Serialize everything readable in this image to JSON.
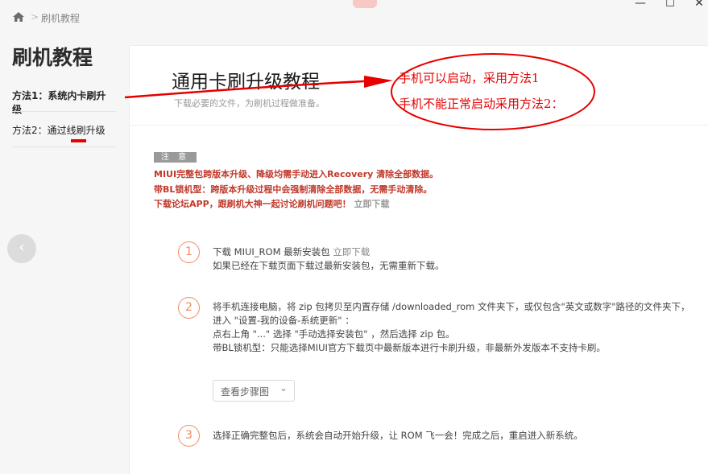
{
  "titlebar": {
    "breadcrumb": "刷机教程",
    "separator": ">",
    "window_controls": [
      "—",
      "☐",
      "✕"
    ]
  },
  "sidebar": {
    "title": "刷机教程",
    "items": [
      {
        "label": "方法1：系统内卡刷升级"
      },
      {
        "label": "方法2：通过线刷升级"
      }
    ],
    "back_glyph": "‹"
  },
  "content": {
    "title": "通用卡刷升级教程",
    "subtitle": "下载必要的文件，为刷机过程做准备。",
    "note_label": "注 意",
    "warnings": [
      "MIUI完整包跨版本升级、降级均需手动进入Recovery 清除全部数据。",
      "带BL锁机型：跨版本升级过程中会强制清除全部数据，无需手动清除。",
      "下载论坛APP，跟刷机大神一起讨论刷机问题吧！"
    ],
    "warning_link": "立即下载",
    "steps": [
      {
        "num": "1",
        "line1_prefix": "下载 MIUI_ROM 最新安装包 ",
        "line1_link": "立即下载",
        "line2": "如果已经在下载页面下载过最新安装包，无需重新下载。"
      },
      {
        "num": "2",
        "line1": "将手机连接电脑，将 zip 包拷贝至内置存储 /downloaded_rom 文件夹下，或仅包含\"英文或数字\"路径的文件夹下，",
        "line2": "进入 \"设置-我的设备-系统更新\" ：",
        "line3": "点右上角 \"...\" 选择 \"手动选择安装包\" ，然后选择 zip 包。",
        "line4": "带BL锁机型：只能选择MIUI官方下载页中最新版本进行卡刷升级，非最新外发版本不支持卡刷。",
        "dropdown": "查看步骤图",
        "dropdown_arrow": "⌄"
      },
      {
        "num": "3",
        "line1": "选择正确完整包后，系统会自动开始升级，让 ROM 飞一会！完成之后，重启进入新系统。"
      }
    ]
  },
  "annotation": {
    "color": "#e60000",
    "line1": "手机可以启动，采用方法1",
    "line2": "手机不能正常启动采用方法2："
  }
}
